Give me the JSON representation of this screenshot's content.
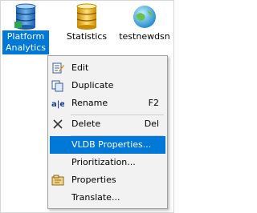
{
  "desktop": {
    "items": [
      {
        "label_line1": "Platform",
        "label_line2": "Analytics",
        "icon": "database-cylinder-icon",
        "selected": true
      },
      {
        "label": "Statistics",
        "icon": "database-cylinder-icon"
      },
      {
        "label": "testnewdsn",
        "icon": "globe-icon"
      }
    ]
  },
  "context_menu": {
    "items": [
      {
        "label": "Edit",
        "icon": "edit-icon"
      },
      {
        "label": "Duplicate",
        "icon": "duplicate-icon"
      },
      {
        "label": "Rename",
        "shortcut": "F2",
        "icon": "rename-icon"
      },
      {
        "label": "Delete",
        "shortcut": "Del",
        "icon": "close-icon"
      },
      {
        "label": "VLDB Properties...",
        "highlighted": true
      },
      {
        "label": "Prioritization..."
      },
      {
        "label": "Properties",
        "icon": "properties-icon"
      },
      {
        "label": "Translate..."
      }
    ]
  },
  "colors": {
    "selection": "#0078d7",
    "menu_bg": "#f2f2f2"
  }
}
